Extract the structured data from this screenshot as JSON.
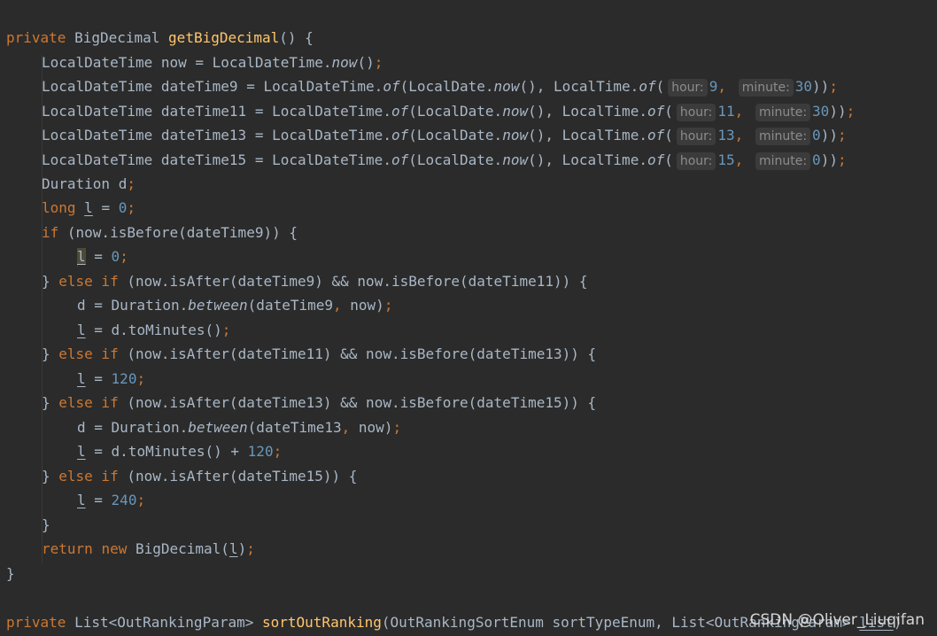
{
  "code": {
    "method1": {
      "signature": {
        "kw_private": "private",
        "ret_type": "BigDecimal",
        "name": "getBigDecimal",
        "params": "() {"
      },
      "now_line": {
        "type": "LocalDateTime",
        "rest": " now = LocalDateTime.",
        "call": "now",
        "end": "()",
        "semi": ";"
      },
      "dt_lines": [
        {
          "decl": "LocalDateTime dateTime9 = LocalDateTime.",
          "of": "of",
          "open": "(LocalDate.",
          "now": "now",
          "mid": "(), LocalTime.",
          "of2": "of",
          "paren": "(",
          "hour_hint": "hour:",
          "hour": "9",
          "comma": ",",
          "minute_hint": "minute:",
          "minute": "30",
          "close": "))",
          "semi": ";"
        },
        {
          "decl": "LocalDateTime dateTime11 = LocalDateTime.",
          "of": "of",
          "open": "(LocalDate.",
          "now": "now",
          "mid": "(), LocalTime.",
          "of2": "of",
          "paren": "(",
          "hour_hint": "hour:",
          "hour": "11",
          "comma": ",",
          "minute_hint": "minute:",
          "minute": "30",
          "close": "))",
          "semi": ";"
        },
        {
          "decl": "LocalDateTime dateTime13 = LocalDateTime.",
          "of": "of",
          "open": "(LocalDate.",
          "now": "now",
          "mid": "(), LocalTime.",
          "of2": "of",
          "paren": "(",
          "hour_hint": "hour:",
          "hour": "13",
          "comma": ",",
          "minute_hint": "minute:",
          "minute": "0",
          "close": "))",
          "semi": ";"
        },
        {
          "decl": "LocalDateTime dateTime15 = LocalDateTime.",
          "of": "of",
          "open": "(LocalDate.",
          "now": "now",
          "mid": "(), LocalTime.",
          "of2": "of",
          "paren": "(",
          "hour_hint": "hour:",
          "hour": "15",
          "comma": ",",
          "minute_hint": "minute:",
          "minute": "0",
          "close": "))",
          "semi": ";"
        }
      ],
      "duration_decl": {
        "text": "Duration d",
        "semi": ";"
      },
      "long_decl": {
        "kw": "long",
        "var": "l",
        "eq": " = ",
        "val": "0",
        "semi": ";"
      },
      "if1": {
        "kw": "if",
        "cond": " (now.isBefore(dateTime9)) {"
      },
      "assign0": {
        "var": "l",
        "eq": " = ",
        "val": "0",
        "semi": ";"
      },
      "elseif1": {
        "brace": "} ",
        "kw": "else if",
        "cond": " (now.isAfter(dateTime9) && now.isBefore(dateTime11)) {"
      },
      "d1": {
        "pre": "d = Duration.",
        "call": "between",
        "args": "(dateTime9",
        "comma": ",",
        "args2": " now)",
        "semi": ";"
      },
      "l1": {
        "var": "l",
        "rest": " = d.toMinutes()",
        "semi": ";"
      },
      "elseif2": {
        "brace": "} ",
        "kw": "else if",
        "cond": " (now.isAfter(dateTime11) && now.isBefore(dateTime13)) {"
      },
      "l120": {
        "var": "l",
        "eq": " = ",
        "val": "120",
        "semi": ";"
      },
      "elseif3": {
        "brace": "} ",
        "kw": "else if",
        "cond": " (now.isAfter(dateTime13) && now.isBefore(dateTime15)) {"
      },
      "d2": {
        "pre": "d = Duration.",
        "call": "between",
        "args": "(dateTime13",
        "comma": ",",
        "args2": " now)",
        "semi": ";"
      },
      "l2": {
        "var": "l",
        "rest": " = d.toMinutes() + ",
        "val": "120",
        "semi": ";"
      },
      "elseif4": {
        "brace": "} ",
        "kw": "else if",
        "cond": " (now.isAfter(dateTime15)) {"
      },
      "l240": {
        "var": "l",
        "eq": " = ",
        "val": "240",
        "semi": ";"
      },
      "close_if": "}",
      "ret": {
        "kw_return": "return",
        "kw_new": "new",
        "rest": " BigDecimal(",
        "var": "l",
        "end": ")",
        "semi": ";"
      },
      "close_method": "}"
    },
    "method2": {
      "kw_private": "private",
      "ret_type": " List<OutRankingParam> ",
      "name": "sortOutRanking",
      "params": "(OutRankingSortEnum sortTypeEnum, List<OutRankingParam> ",
      "list": "list",
      "end": ")"
    }
  },
  "watermark": "CSDN @Oliver_Liuqifan",
  "colors": {
    "background": "#2b2b2b",
    "text": "#a9b7c6",
    "keyword": "#cc7832",
    "function": "#ffc66d",
    "number": "#6897bb"
  }
}
